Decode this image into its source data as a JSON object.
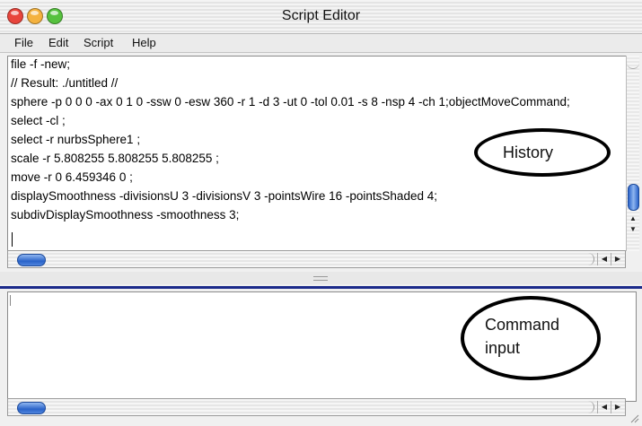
{
  "window": {
    "title": "Script Editor",
    "traffic_lights": [
      {
        "name": "close",
        "color": "#e8453c"
      },
      {
        "name": "minimize",
        "color": "#f4b23f"
      },
      {
        "name": "zoom",
        "color": "#56c13e"
      }
    ]
  },
  "menubar": {
    "items": [
      "File",
      "Edit",
      "Script",
      "Help"
    ]
  },
  "history": {
    "lines": [
      "file -f -new;",
      "// Result: ./untitled //",
      "sphere -p 0 0 0 -ax 0 1 0 -ssw 0 -esw 360 -r 1 -d 3 -ut 0 -tol 0.01 -s 8 -nsp 4 -ch 1;objectMoveCommand;",
      "select -cl  ;",
      "select -r nurbsSphere1 ;",
      "scale -r 5.808255 5.808255 5.808255 ;",
      "move -r 0 6.459346 0 ;",
      "displaySmoothness -divisionsU 3 -divisionsV 3 -pointsWire 16 -pointsShaded 4;",
      "subdivDisplaySmoothness -smoothness 3;"
    ]
  },
  "command_input": {
    "text": ""
  },
  "annotations": {
    "history_label": "History",
    "command_label_line1": "Command",
    "command_label_line2": "input"
  },
  "icons": {
    "scroll_up": "scroll-up-arrow-icon",
    "scroll_down": "scroll-down-arrow-icon",
    "scroll_left": "scroll-left-arrow-icon",
    "scroll_right": "scroll-right-arrow-icon"
  },
  "colors": {
    "accent_blue": "#2a63c9",
    "divider_blue": "#1b2a8a"
  }
}
